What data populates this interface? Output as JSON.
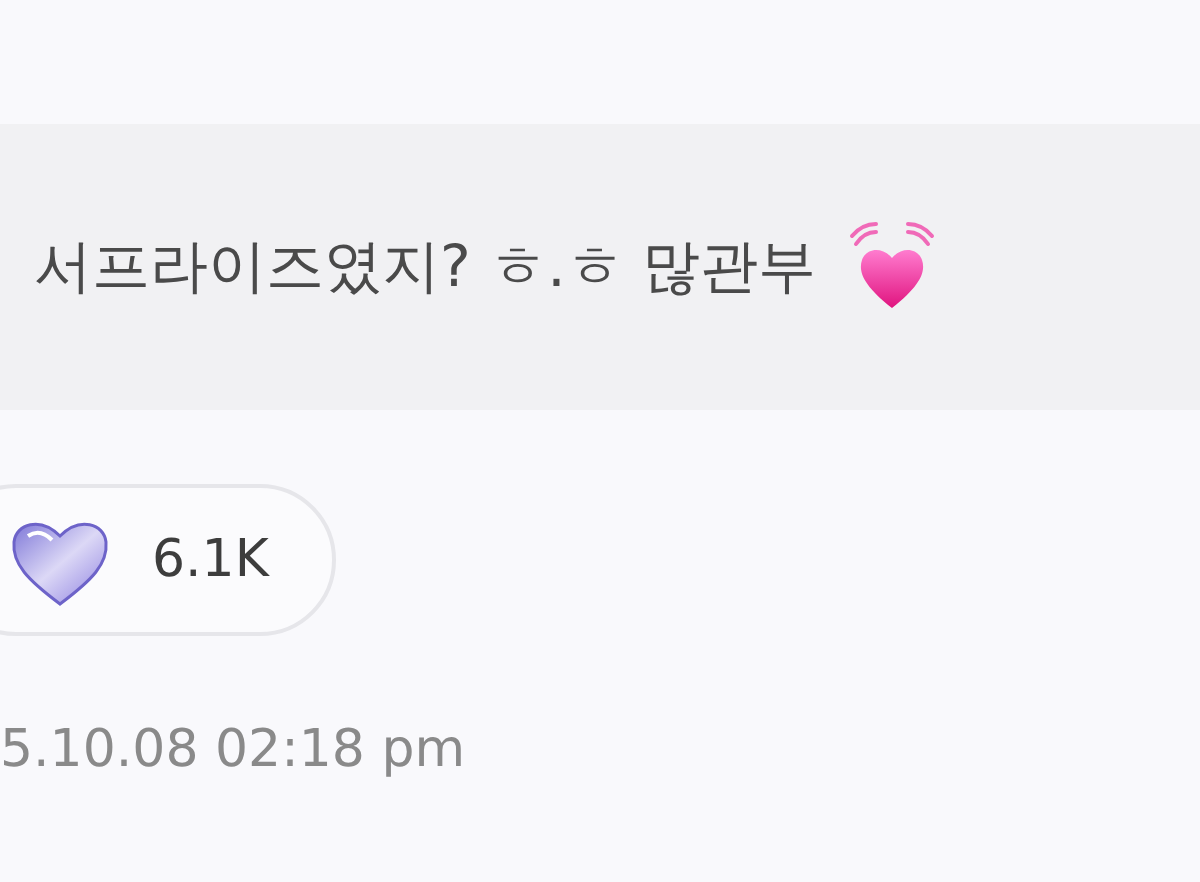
{
  "message": {
    "text": "서프라이즈였지? ㅎ.ㅎ 많관부"
  },
  "reaction": {
    "count": "6.1K"
  },
  "timestamp": "5.10.08 02:18 pm"
}
